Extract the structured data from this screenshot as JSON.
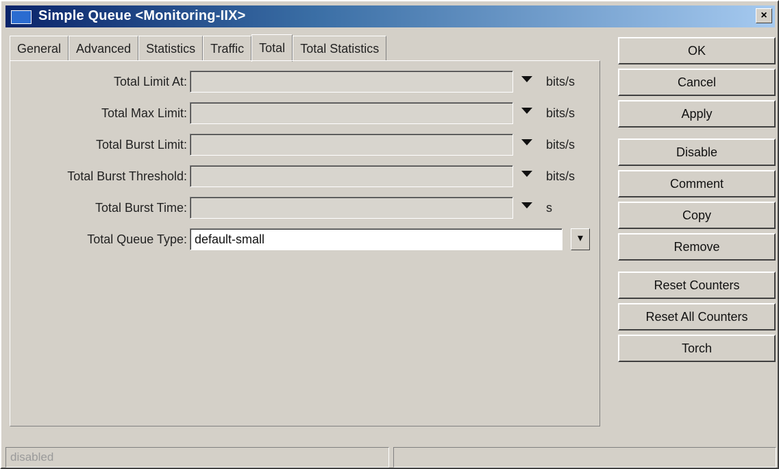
{
  "window": {
    "title": "Simple Queue <Monitoring-IIX>",
    "close_glyph": "×",
    "icon": "window-icon"
  },
  "tabs": [
    {
      "label": "General",
      "active": false
    },
    {
      "label": "Advanced",
      "active": false
    },
    {
      "label": "Statistics",
      "active": false
    },
    {
      "label": "Traffic",
      "active": false
    },
    {
      "label": "Total",
      "active": true
    },
    {
      "label": "Total Statistics",
      "active": false
    }
  ],
  "fields": [
    {
      "label": "Total Limit At:",
      "value": "",
      "unit": "bits/s"
    },
    {
      "label": "Total Max Limit:",
      "value": "",
      "unit": "bits/s"
    },
    {
      "label": "Total Burst Limit:",
      "value": "",
      "unit": "bits/s"
    },
    {
      "label": "Total Burst Threshold:",
      "value": "",
      "unit": "bits/s"
    },
    {
      "label": "Total Burst Time:",
      "value": "",
      "unit": "s"
    }
  ],
  "queue_type": {
    "label": "Total Queue Type:",
    "value": "default-small",
    "button_glyph": "▾"
  },
  "buttons": {
    "ok": "OK",
    "cancel": "Cancel",
    "apply": "Apply",
    "disable": "Disable",
    "comment": "Comment",
    "copy": "Copy",
    "remove": "Remove",
    "reset_counters": "Reset Counters",
    "reset_all_counters": "Reset All Counters",
    "torch": "Torch"
  },
  "status": {
    "left": "disabled",
    "right": ""
  },
  "colors": {
    "titlebar_start": "#0a246a",
    "titlebar_end": "#a6caf0",
    "face": "#d4d0c8"
  }
}
